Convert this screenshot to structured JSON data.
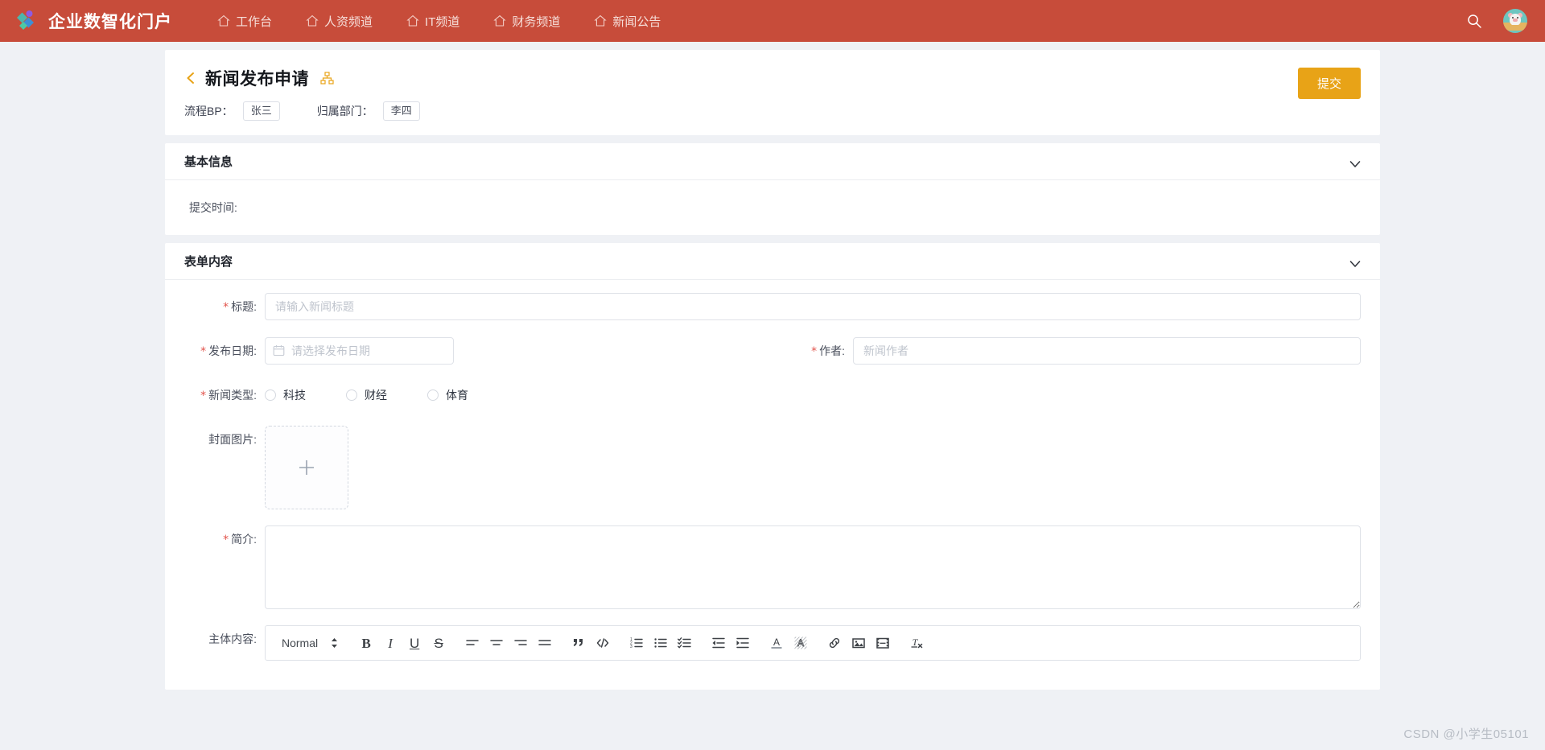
{
  "nav": {
    "brand": "企业数智化门户",
    "logo_icon": "leaf-chevron-logo",
    "links": [
      {
        "label": "工作台",
        "icon": "home-icon"
      },
      {
        "label": "人资频道",
        "icon": "home-icon"
      },
      {
        "label": "IT频道",
        "icon": "home-icon"
      },
      {
        "label": "财务频道",
        "icon": "home-icon"
      },
      {
        "label": "新闻公告",
        "icon": "home-icon"
      }
    ],
    "search_icon": "search-icon",
    "avatar_icon": "user-avatar"
  },
  "header": {
    "back_icon": "chevron-left-icon",
    "title": "新闻发布申请",
    "org_icon": "org-chart-icon",
    "bp_label": "流程BP：",
    "bp_value": "张三",
    "dept_label": "归属部门：",
    "dept_value": "李四",
    "submit_label": "提交"
  },
  "basic_section": {
    "title": "基本信息",
    "collapse_icon": "chevron-down-icon",
    "submit_time_label": "提交时间:",
    "submit_time_value": ""
  },
  "form_section": {
    "title": "表单内容",
    "collapse_icon": "chevron-down-icon",
    "fields": {
      "title": {
        "required": "*",
        "label": "标题:",
        "placeholder": "请输入新闻标题",
        "value": ""
      },
      "publish_date": {
        "required": "*",
        "label": "发布日期:",
        "placeholder": "请选择发布日期",
        "value": "",
        "icon": "calendar-icon"
      },
      "author": {
        "required": "*",
        "label": "作者:",
        "placeholder": "新闻作者",
        "value": ""
      },
      "news_type": {
        "required": "*",
        "label": "新闻类型:",
        "options": [
          "科技",
          "财经",
          "体育"
        ],
        "selected": ""
      },
      "cover_image": {
        "label": "封面图片:",
        "upload_icon": "plus-icon"
      },
      "summary": {
        "required": "*",
        "label": "简介:",
        "value": ""
      },
      "body": {
        "label": "主体内容:",
        "value": ""
      }
    }
  },
  "editor_toolbar": {
    "format_select": "Normal",
    "buttons": [
      {
        "name": "bold",
        "glyph": "B"
      },
      {
        "name": "italic",
        "glyph": "I"
      },
      {
        "name": "underline",
        "glyph": "U"
      },
      {
        "name": "strike",
        "glyph": "S"
      },
      {
        "name": "align-left",
        "glyph": ""
      },
      {
        "name": "align-center",
        "glyph": ""
      },
      {
        "name": "align-right",
        "glyph": ""
      },
      {
        "name": "align-justify",
        "glyph": ""
      },
      {
        "name": "blockquote",
        "glyph": ""
      },
      {
        "name": "code-block",
        "glyph": ""
      },
      {
        "name": "ordered-list",
        "glyph": ""
      },
      {
        "name": "bullet-list",
        "glyph": ""
      },
      {
        "name": "check-list",
        "glyph": ""
      },
      {
        "name": "outdent",
        "glyph": ""
      },
      {
        "name": "indent",
        "glyph": ""
      },
      {
        "name": "text-color",
        "glyph": "A"
      },
      {
        "name": "background-color",
        "glyph": "A"
      },
      {
        "name": "link",
        "glyph": ""
      },
      {
        "name": "image",
        "glyph": ""
      },
      {
        "name": "video",
        "glyph": ""
      },
      {
        "name": "clear-format",
        "glyph": ""
      }
    ]
  },
  "watermark": "CSDN @小学生05101",
  "colors": {
    "nav_bg": "#c74c3a",
    "accent": "#e8a317",
    "page_bg": "#eff1f5",
    "required": "#e2554d"
  }
}
